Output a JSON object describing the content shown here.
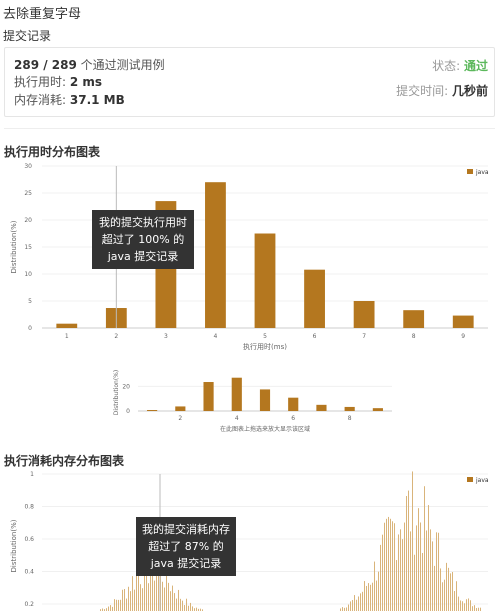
{
  "page": {
    "title": "去除重复字母",
    "subtitle": "提交记录"
  },
  "submission": {
    "passed_count": "289 / 289",
    "passed_suffix": "个通过测试用例",
    "runtime_label": "执行用时:",
    "runtime_value": "2 ms",
    "memory_label": "内存消耗:",
    "memory_value": "37.1 MB",
    "status_label": "状态:",
    "status_value": "通过",
    "submit_time_label": "提交时间:",
    "submit_time_value": "几秒前"
  },
  "runtime_section": {
    "title": "执行用时分布图表",
    "tooltip_lines": [
      "我的提交执行用时",
      "超过了 100% 的",
      "java 提交记录"
    ],
    "navigator_label": "在此图表上拖选来放大显示该区域",
    "navigator_ylabel": "Distribution(%)",
    "navigator_ytick": "20",
    "navigator_ytick0": "0"
  },
  "memory_section": {
    "title": "执行消耗内存分布图表",
    "tooltip_lines": [
      "我的提交消耗内存",
      "超过了 87% 的",
      "java 提交记录"
    ],
    "ylabel": "Distribution(%)",
    "legend": "java",
    "yticks": [
      "1",
      "0.8",
      "0.6",
      "0.4",
      "0.2"
    ]
  },
  "colors": {
    "bar": "#b4771f",
    "memory_bar": "#d9b47a",
    "accent_green": "#5cb85c"
  },
  "chart_data": [
    {
      "type": "bar",
      "title": "",
      "xlabel": "执行用时(ms)",
      "ylabel": "Distribution(%)",
      "categories": [
        "1",
        "2",
        "3",
        "4",
        "5",
        "6",
        "7",
        "8",
        "9"
      ],
      "series": [
        {
          "name": "java",
          "values": [
            0.8,
            3.7,
            23.5,
            27,
            17.5,
            10.8,
            5,
            3.3,
            2.3
          ]
        }
      ],
      "ylim": [
        0,
        30
      ],
      "yticks": [
        0,
        5,
        10,
        15,
        20,
        25,
        30
      ],
      "legend": "top-right",
      "marker_category": "2"
    },
    {
      "type": "bar",
      "title": "",
      "xlabel": "在此图表上拖选来放大显示该区域",
      "ylabel": "Distribution(%)",
      "x_ticks": [
        "2",
        "4",
        "6",
        "8"
      ],
      "values": [
        0.8,
        3.7,
        23.5,
        27,
        17.5,
        10.8,
        5,
        3.3,
        2.3
      ],
      "ylim": [
        0,
        30
      ]
    }
  ]
}
